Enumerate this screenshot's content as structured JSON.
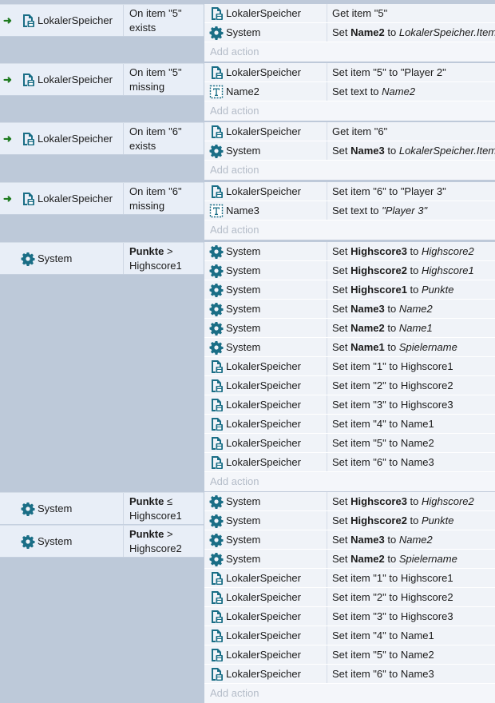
{
  "add_action_label": "Add action",
  "icon_color": "#1a6e86",
  "blocks": [
    {
      "conditions": [
        {
          "object": "LokalerSpeicher",
          "icon": "storage-icon",
          "trigger": true,
          "line1": "On item \"5\"",
          "line2": "exists"
        }
      ],
      "actions": [
        {
          "object": "LokalerSpeicher",
          "icon": "storage-icon",
          "parts": [
            {
              "t": "Get item \"5\"",
              "s": ""
            }
          ]
        },
        {
          "object": "System",
          "icon": "gear-icon",
          "parts": [
            {
              "t": "Set ",
              "s": ""
            },
            {
              "t": "Name2",
              "s": "b"
            },
            {
              "t": " to ",
              "s": ""
            },
            {
              "t": "LokalerSpeicher.ItemV",
              "s": "i"
            }
          ]
        }
      ]
    },
    {
      "conditions": [
        {
          "object": "LokalerSpeicher",
          "icon": "storage-icon",
          "trigger": true,
          "line1": "On item \"5\"",
          "line2": "missing"
        }
      ],
      "actions": [
        {
          "object": "LokalerSpeicher",
          "icon": "storage-icon",
          "parts": [
            {
              "t": "Set item \"5\" to \"Player 2\"",
              "s": ""
            }
          ]
        },
        {
          "object": "Name2",
          "icon": "text-object-icon",
          "parts": [
            {
              "t": "Set text to ",
              "s": ""
            },
            {
              "t": "Name2",
              "s": "i"
            }
          ]
        }
      ]
    },
    {
      "conditions": [
        {
          "object": "LokalerSpeicher",
          "icon": "storage-icon",
          "trigger": true,
          "line1": "On item \"6\"",
          "line2": "exists"
        }
      ],
      "actions": [
        {
          "object": "LokalerSpeicher",
          "icon": "storage-icon",
          "parts": [
            {
              "t": "Get item \"6\"",
              "s": ""
            }
          ]
        },
        {
          "object": "System",
          "icon": "gear-icon",
          "parts": [
            {
              "t": "Set ",
              "s": ""
            },
            {
              "t": "Name3",
              "s": "b"
            },
            {
              "t": " to ",
              "s": ""
            },
            {
              "t": "LokalerSpeicher.ItemV",
              "s": "i"
            }
          ]
        }
      ]
    },
    {
      "conditions": [
        {
          "object": "LokalerSpeicher",
          "icon": "storage-icon",
          "trigger": true,
          "line1": "On item \"6\"",
          "line2": "missing"
        }
      ],
      "actions": [
        {
          "object": "LokalerSpeicher",
          "icon": "storage-icon",
          "parts": [
            {
              "t": "Set item \"6\" to \"Player 3\"",
              "s": ""
            }
          ]
        },
        {
          "object": "Name3",
          "icon": "text-object-icon",
          "parts": [
            {
              "t": "Set text to ",
              "s": ""
            },
            {
              "t": "\"Player 3\"",
              "s": "i"
            }
          ]
        }
      ]
    },
    {
      "conditions": [
        {
          "object": "System",
          "icon": "gear-icon",
          "trigger": false,
          "line1b": "Punkte",
          "line1": " >",
          "line2": "Highscore1"
        }
      ],
      "actions": [
        {
          "object": "System",
          "icon": "gear-icon",
          "parts": [
            {
              "t": "Set ",
              "s": ""
            },
            {
              "t": "Highscore3",
              "s": "b"
            },
            {
              "t": " to ",
              "s": ""
            },
            {
              "t": "Highscore2",
              "s": "i"
            }
          ]
        },
        {
          "object": "System",
          "icon": "gear-icon",
          "parts": [
            {
              "t": "Set ",
              "s": ""
            },
            {
              "t": "Highscore2",
              "s": "b"
            },
            {
              "t": " to ",
              "s": ""
            },
            {
              "t": "Highscore1",
              "s": "i"
            }
          ]
        },
        {
          "object": "System",
          "icon": "gear-icon",
          "parts": [
            {
              "t": "Set ",
              "s": ""
            },
            {
              "t": "Highscore1",
              "s": "b"
            },
            {
              "t": " to ",
              "s": ""
            },
            {
              "t": "Punkte",
              "s": "i"
            }
          ]
        },
        {
          "object": "System",
          "icon": "gear-icon",
          "parts": [
            {
              "t": "Set ",
              "s": ""
            },
            {
              "t": "Name3",
              "s": "b"
            },
            {
              "t": " to ",
              "s": ""
            },
            {
              "t": "Name2",
              "s": "i"
            }
          ]
        },
        {
          "object": "System",
          "icon": "gear-icon",
          "parts": [
            {
              "t": "Set ",
              "s": ""
            },
            {
              "t": "Name2",
              "s": "b"
            },
            {
              "t": " to ",
              "s": ""
            },
            {
              "t": "Name1",
              "s": "i"
            }
          ]
        },
        {
          "object": "System",
          "icon": "gear-icon",
          "parts": [
            {
              "t": "Set ",
              "s": ""
            },
            {
              "t": "Name1",
              "s": "b"
            },
            {
              "t": " to ",
              "s": ""
            },
            {
              "t": "Spielername",
              "s": "i"
            }
          ]
        },
        {
          "object": "LokalerSpeicher",
          "icon": "storage-icon",
          "parts": [
            {
              "t": "Set item \"1\" to Highscore1",
              "s": ""
            }
          ]
        },
        {
          "object": "LokalerSpeicher",
          "icon": "storage-icon",
          "parts": [
            {
              "t": "Set item \"2\" to Highscore2",
              "s": ""
            }
          ]
        },
        {
          "object": "LokalerSpeicher",
          "icon": "storage-icon",
          "parts": [
            {
              "t": "Set item \"3\" to Highscore3",
              "s": ""
            }
          ]
        },
        {
          "object": "LokalerSpeicher",
          "icon": "storage-icon",
          "parts": [
            {
              "t": "Set item \"4\" to Name1",
              "s": ""
            }
          ]
        },
        {
          "object": "LokalerSpeicher",
          "icon": "storage-icon",
          "parts": [
            {
              "t": "Set item \"5\" to Name2",
              "s": ""
            }
          ]
        },
        {
          "object": "LokalerSpeicher",
          "icon": "storage-icon",
          "parts": [
            {
              "t": "Set item \"6\" to Name3",
              "s": ""
            }
          ]
        }
      ]
    },
    {
      "conditions": [
        {
          "object": "System",
          "icon": "gear-icon",
          "trigger": false,
          "line1b": "Punkte",
          "line1": " ≤",
          "line2": "Highscore1"
        },
        {
          "object": "System",
          "icon": "gear-icon",
          "trigger": false,
          "line1b": "Punkte",
          "line1": " >",
          "line2": "Highscore2"
        }
      ],
      "actions": [
        {
          "object": "System",
          "icon": "gear-icon",
          "parts": [
            {
              "t": "Set ",
              "s": ""
            },
            {
              "t": "Highscore3",
              "s": "b"
            },
            {
              "t": " to ",
              "s": ""
            },
            {
              "t": "Highscore2",
              "s": "i"
            }
          ]
        },
        {
          "object": "System",
          "icon": "gear-icon",
          "parts": [
            {
              "t": "Set ",
              "s": ""
            },
            {
              "t": "Highscore2",
              "s": "b"
            },
            {
              "t": " to ",
              "s": ""
            },
            {
              "t": "Punkte",
              "s": "i"
            }
          ]
        },
        {
          "object": "System",
          "icon": "gear-icon",
          "parts": [
            {
              "t": "Set ",
              "s": ""
            },
            {
              "t": "Name3",
              "s": "b"
            },
            {
              "t": " to ",
              "s": ""
            },
            {
              "t": "Name2",
              "s": "i"
            }
          ]
        },
        {
          "object": "System",
          "icon": "gear-icon",
          "parts": [
            {
              "t": "Set ",
              "s": ""
            },
            {
              "t": "Name2",
              "s": "b"
            },
            {
              "t": " to ",
              "s": ""
            },
            {
              "t": "Spielername",
              "s": "i"
            }
          ]
        },
        {
          "object": "LokalerSpeicher",
          "icon": "storage-icon",
          "parts": [
            {
              "t": "Set item \"1\" to Highscore1",
              "s": ""
            }
          ]
        },
        {
          "object": "LokalerSpeicher",
          "icon": "storage-icon",
          "parts": [
            {
              "t": "Set item \"2\" to Highscore2",
              "s": ""
            }
          ]
        },
        {
          "object": "LokalerSpeicher",
          "icon": "storage-icon",
          "parts": [
            {
              "t": "Set item \"3\" to Highscore3",
              "s": ""
            }
          ]
        },
        {
          "object": "LokalerSpeicher",
          "icon": "storage-icon",
          "parts": [
            {
              "t": "Set item \"4\" to Name1",
              "s": ""
            }
          ]
        },
        {
          "object": "LokalerSpeicher",
          "icon": "storage-icon",
          "parts": [
            {
              "t": "Set item \"5\" to Name2",
              "s": ""
            }
          ]
        },
        {
          "object": "LokalerSpeicher",
          "icon": "storage-icon",
          "parts": [
            {
              "t": "Set item \"6\" to Name3",
              "s": ""
            }
          ]
        }
      ]
    }
  ]
}
